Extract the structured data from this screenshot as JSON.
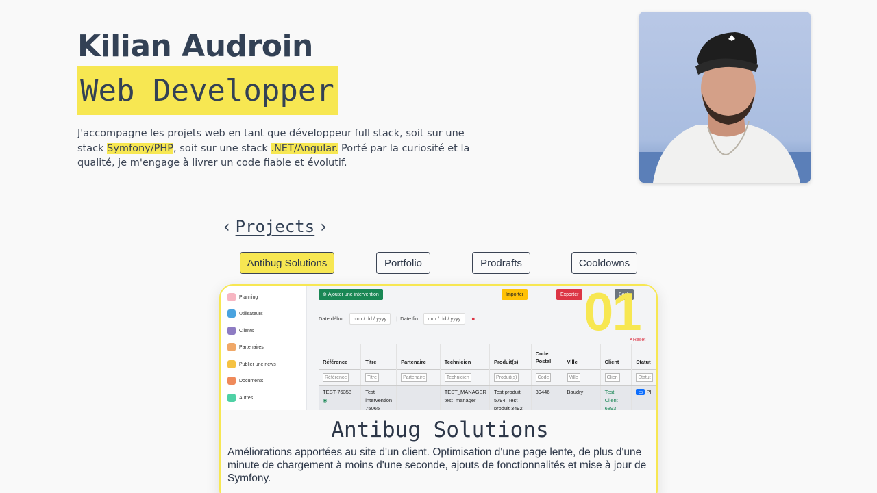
{
  "hero": {
    "name": "Kilian Audroin",
    "role": "Web Developper",
    "intro_part1": "J'accompagne les projets web en tant que développeur full stack, soit sur une stack ",
    "intro_hl1": "Symfony/PHP",
    "intro_part2": ", soit sur une stack ",
    "intro_hl2": ".NET/Angular.",
    "intro_part3": " Porté par la curiosité et la qualité, je m'engage à livrer un code fiable et évolutif."
  },
  "projects": {
    "heading": "Projects",
    "prev_icon": "‹",
    "next_icon": "›",
    "tabs": [
      {
        "label": "Antibug Solutions",
        "active": true
      },
      {
        "label": "Portfolio",
        "active": false
      },
      {
        "label": "Prodrafts",
        "active": false
      },
      {
        "label": "Cooldowns",
        "active": false
      }
    ],
    "current": {
      "number": "01",
      "title": "Antibug Solutions",
      "description": "Améliorations apportées au site d'un client. Optimisation d'une page lente, de plus d'une minute de chargement à moins d'une seconde, ajouts de fonctionnalités et mise à jour de Symfony."
    }
  },
  "screenshot": {
    "sidebar": [
      "Planning",
      "Utilisateurs",
      "Clients",
      "Partenaires",
      "Publier une news",
      "Documents",
      "Autres"
    ],
    "add_button": "Ajouter une intervention",
    "import_button": "Importer",
    "export_button": "Exporter",
    "back_button": "Back",
    "date_start_label": "Date début :",
    "date_end_label": "Date fin :",
    "date_placeholder": "mm / dd / yyyy",
    "reset": "✕Reset",
    "columns": [
      "Référence",
      "Titre",
      "Partenaire",
      "Technicien",
      "Produit(s)",
      "Code Postal",
      "Ville",
      "Client",
      "Statut"
    ],
    "filters": [
      "Référence",
      "Titre",
      "Partenaire",
      "Technicien",
      "Produit(s)",
      "Code",
      "Ville",
      "Clien",
      "Statut"
    ],
    "row": {
      "reference": "TEST-76358",
      "titre": "Test intervention 75065",
      "partenaire": "",
      "technicien": "TEST_MANAGER test_manager",
      "produits": "Test produit 5794, Test produit 3492",
      "code_postal": "39446",
      "ville": "Baudry",
      "client": "Test Client 6893",
      "statut": "Pl"
    }
  },
  "colors": {
    "accent": "#f7e752",
    "text": "#334155"
  }
}
